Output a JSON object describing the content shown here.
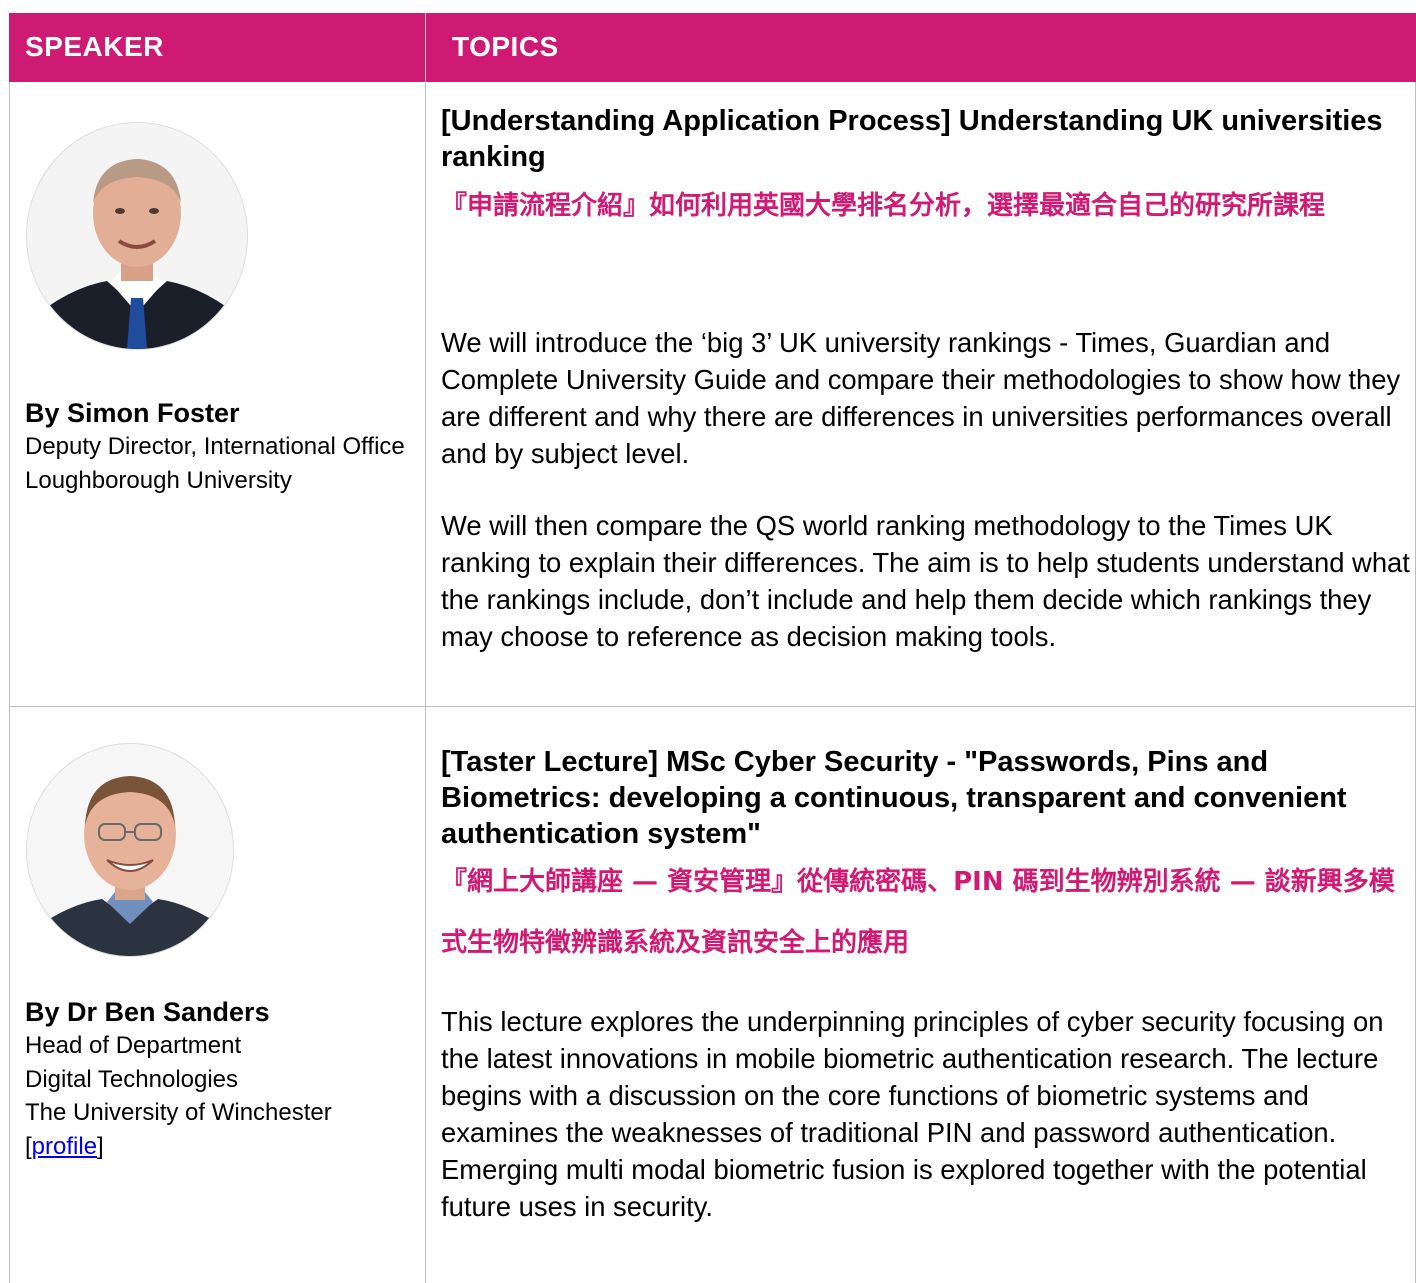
{
  "header": {
    "speaker": "SPEAKER",
    "topics": "TOPICS"
  },
  "colors": {
    "accent": "#cf1a74",
    "link": "#0000ee",
    "border": "#bfbfbf"
  },
  "rows": [
    {
      "speaker": {
        "name": "By Simon Foster",
        "lines": [
          "Deputy Director, International Office",
          "Loughborough University"
        ]
      },
      "title_en": "[Understanding Application Process] Understanding UK universities ranking",
      "title_zh": "『申請流程介紹』如何利用英國大學排名分析，選擇最適合自己的研究所課程",
      "paragraphs": [
        "We will introduce the ‘big 3’ UK university rankings - Times, Guardian and Complete University Guide and compare their methodologies to show how they are different and why there are differences in universities performances overall and by subject level.",
        "We will then compare the QS world ranking methodology to the Times UK ranking to explain their differences. The aim is to help students understand what the rankings include, don’t include and help them decide which rankings they may choose to reference as decision making tools."
      ]
    },
    {
      "speaker": {
        "name": "By Dr Ben Sanders",
        "lines": [
          "Head of Department",
          "Digital Technologies",
          "The University of Winchester"
        ],
        "profile_open": "[",
        "profile_link": "profile",
        "profile_close": "]"
      },
      "title_en": "[Taster Lecture] MSc Cyber Security - \"Passwords, Pins and Biometrics: developing a continuous, transparent and convenient authentication system\"",
      "title_zh": "『網上大師講座 — 資安管理』從傳統密碼、PIN 碼到生物辨別系統 — 談新興多模式生物特徵辨識系統及資訊安全上的應用",
      "paragraphs": [
        "This lecture explores the underpinning principles of cyber security focusing on the latest innovations in mobile biometric authentication research.  The lecture begins with a discussion on the core functions of biometric systems and examines the weaknesses of traditional PIN and password authentication.  Emerging multi modal biometric fusion is explored together with the potential future uses in security."
      ]
    }
  ]
}
